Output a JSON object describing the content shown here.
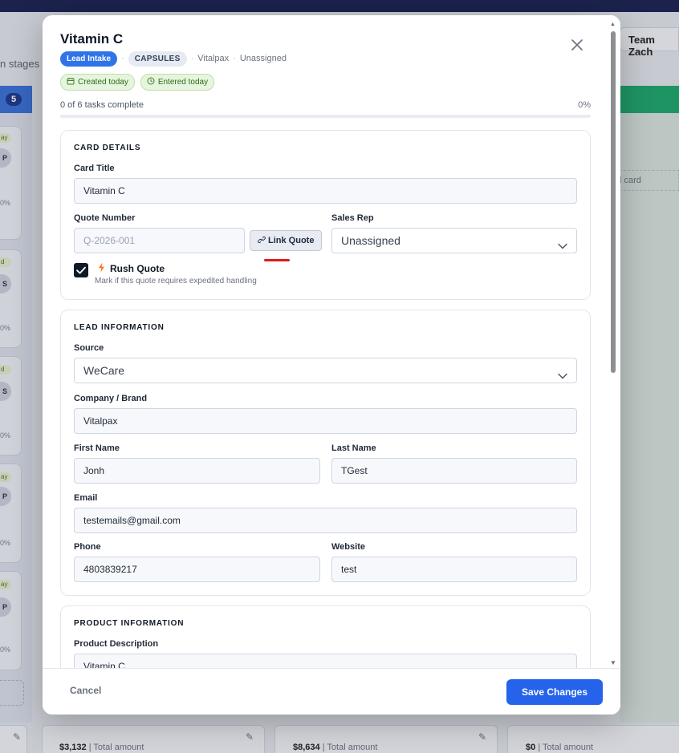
{
  "background": {
    "stages_label": "n stages",
    "team_button": "Team Zach",
    "left_column_count": "5",
    "card_pills": [
      "ay",
      "d",
      "d",
      "ay",
      "ay"
    ],
    "card_avatars": [
      "P",
      "S",
      "S",
      "P",
      "P"
    ],
    "card_pcts": [
      "0%",
      "0%",
      "0%",
      "0%",
      "0%"
    ],
    "add_card_label": "l card",
    "footer_totals": [
      {
        "amount": "$3,132",
        "label": "| Total amount"
      },
      {
        "amount": "$8,634",
        "label": "| Total amount"
      },
      {
        "amount": "$0",
        "label": "| Total amount"
      }
    ]
  },
  "modal": {
    "title": "Vitamin C",
    "stage_badge": "Lead Intake",
    "type_badge": "CAPSULES",
    "company": "Vitalpax",
    "assignee": "Unassigned",
    "separator": "·",
    "tags": {
      "created": "Created today",
      "entered": "Entered today"
    },
    "progress": {
      "label": "0 of 6 tasks complete",
      "percent_text": "0%",
      "fraction": 0.0
    },
    "card_details": {
      "heading": "CARD DETAILS",
      "card_title_label": "Card Title",
      "card_title_value": "Vitamin C",
      "quote_number_label": "Quote Number",
      "quote_number_placeholder": "Q-2026-001",
      "link_quote_label": "Link Quote",
      "sales_rep_label": "Sales Rep",
      "sales_rep_value": "Unassigned",
      "rush_quote_label": "Rush Quote",
      "rush_quote_help": "Mark if this quote requires expedited handling",
      "rush_quote_checked": true
    },
    "lead_information": {
      "heading": "LEAD INFORMATION",
      "source_label": "Source",
      "source_value": "WeCare",
      "company_label": "Company / Brand",
      "company_value": "Vitalpax",
      "first_name_label": "First Name",
      "first_name_value": "Jonh",
      "last_name_label": "Last Name",
      "last_name_value": "TGest",
      "email_label": "Email",
      "email_value": "testemails@gmail.com",
      "phone_label": "Phone",
      "phone_value": "4803839217",
      "website_label": "Website",
      "website_value": "test"
    },
    "product_information": {
      "heading": "PRODUCT INFORMATION",
      "description_label": "Product Description",
      "description_value": "Vitamin C"
    },
    "footer": {
      "cancel_label": "Cancel",
      "save_label": "Save Changes"
    }
  },
  "colors": {
    "primary": "#2563eb",
    "stage_badge": "#2f73e8",
    "tag_green": "#e6f5dd",
    "annotation_red": "#e0191b"
  }
}
